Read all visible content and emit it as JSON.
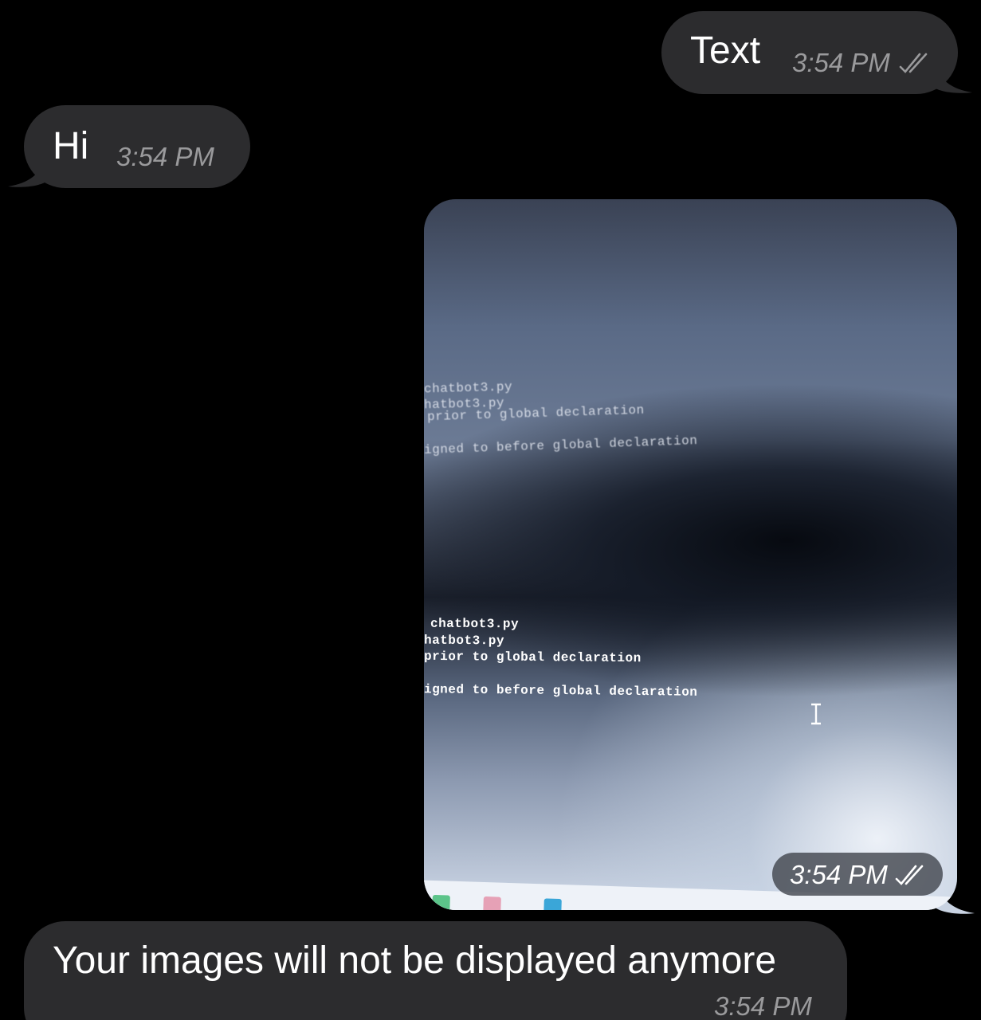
{
  "messages": [
    {
      "direction": "outgoing",
      "text": "Text",
      "time": "3:54 PM",
      "status": "double-check-icon"
    },
    {
      "direction": "incoming",
      "text": "Hi",
      "time": "3:54 PM"
    },
    {
      "direction": "outgoing",
      "type": "photo",
      "time": "3:54 PM",
      "status": "double-check-icon",
      "photo_text": {
        "blurry_lines": [
          "chatbot3.py",
          "hatbot3.py",
          "prior to global declaration",
          "igned to before global declaration"
        ],
        "sharp_lines": [
          "chatbot3.py",
          "hatbot3.py",
          "prior to global declaration",
          "igned to before global declaration"
        ]
      }
    },
    {
      "direction": "incoming",
      "text": "Your images will not be displayed anymore",
      "time": "3:54 PM"
    }
  ],
  "colors": {
    "background": "#000000",
    "bubble": "#2c2c2e",
    "timestamp": "#9a9a9c",
    "text": "#ffffff"
  }
}
